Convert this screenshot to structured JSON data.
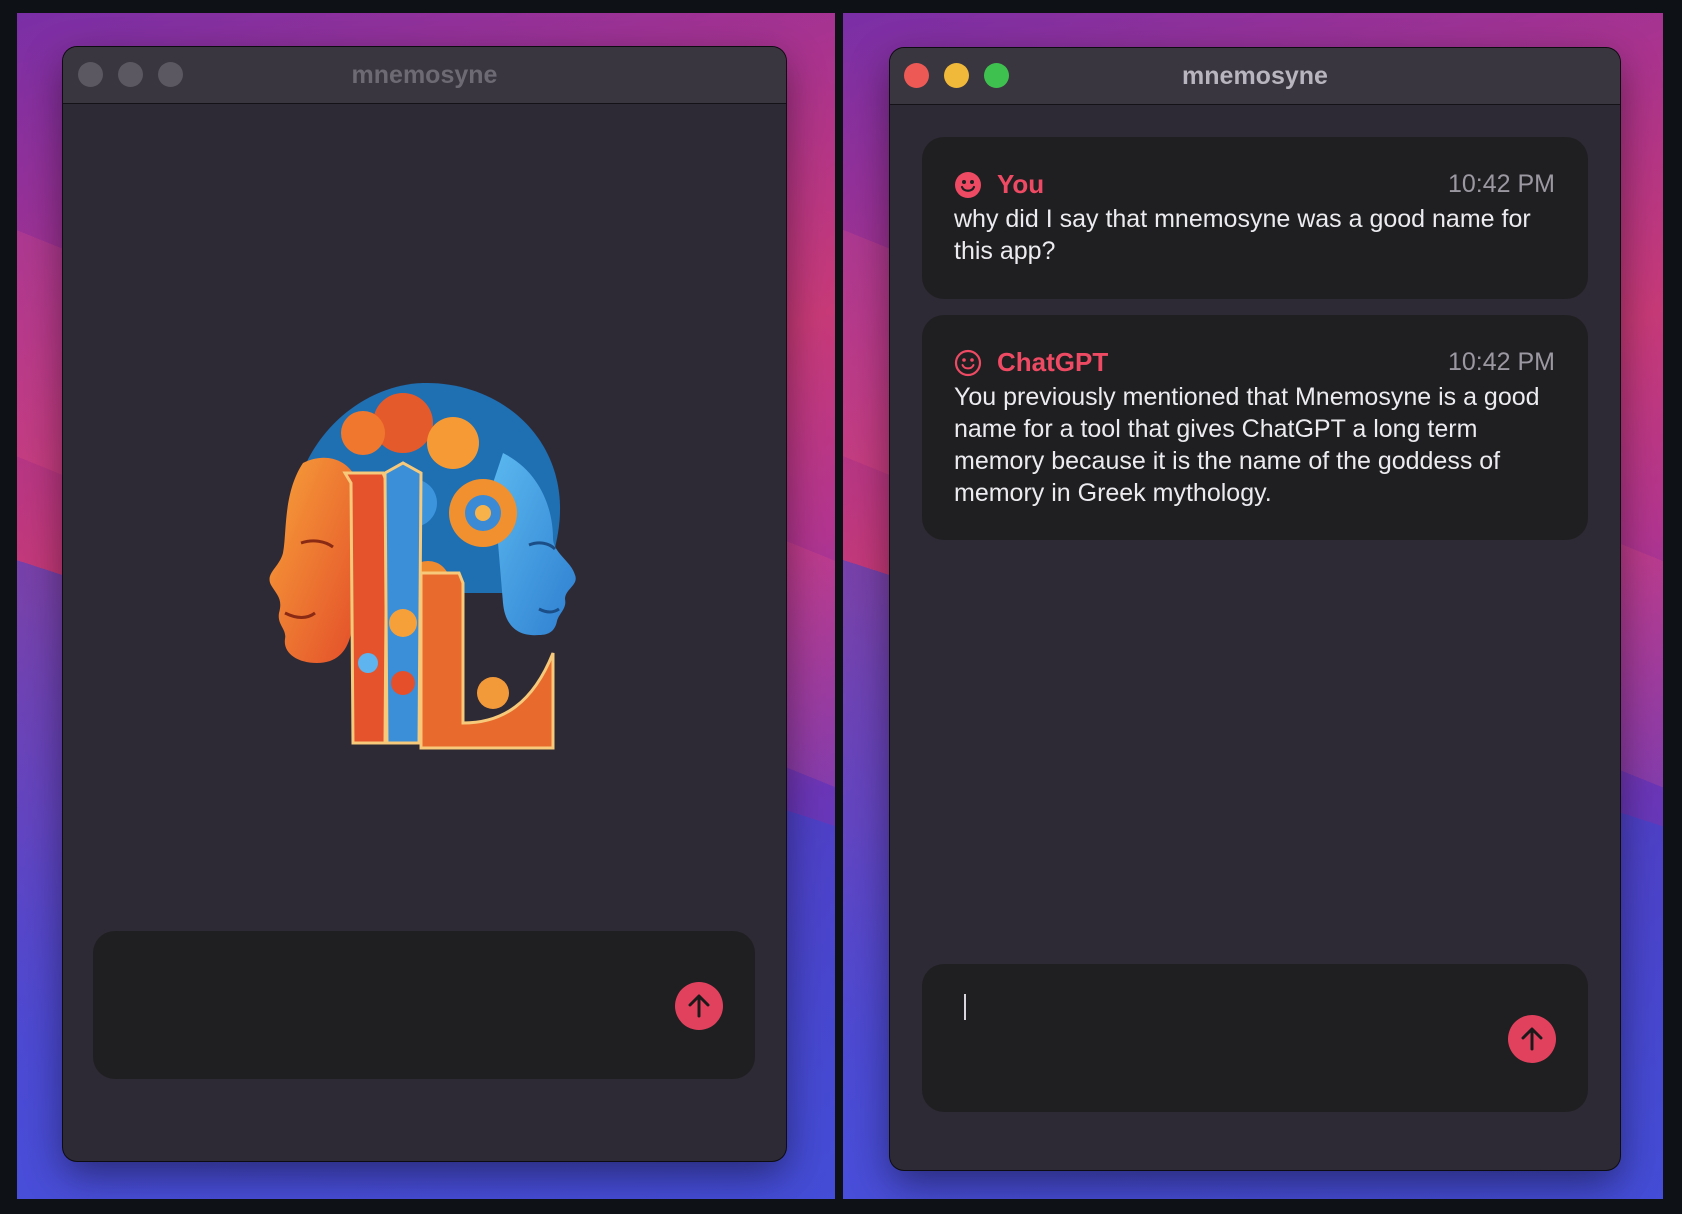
{
  "left_window": {
    "title": "mnemosyne",
    "traffic_lights": {
      "close": "#5b5861",
      "minimize": "#5b5861",
      "zoom": "#5b5861"
    },
    "logo_icon": "head-profiles-letter-l-logo",
    "composer": {
      "value": "",
      "send_icon": "arrow-up-icon"
    }
  },
  "right_window": {
    "title": "mnemosyne",
    "traffic_lights": {
      "close": "#ed5a55",
      "minimize": "#f1b93a",
      "zoom": "#3fc150"
    },
    "messages": [
      {
        "sender": "You",
        "time": "10:42 PM",
        "icon": "smiley-filled-icon",
        "text": "why did I say that mnemosyne was a good name for this app?"
      },
      {
        "sender": "ChatGPT",
        "time": "10:42 PM",
        "icon": "smiley-outline-icon",
        "text": "You previously mentioned that Mnemosyne is a good name for a tool that gives ChatGPT a long term memory because it is the name of the goddess of memory in Greek mythology."
      }
    ],
    "composer": {
      "value": "",
      "send_icon": "arrow-up-icon"
    }
  },
  "colors": {
    "accent": "#e2415e",
    "sender": "#ef4a64",
    "window_bg": "#2e2a35",
    "bubble_bg": "#1f1f21"
  }
}
